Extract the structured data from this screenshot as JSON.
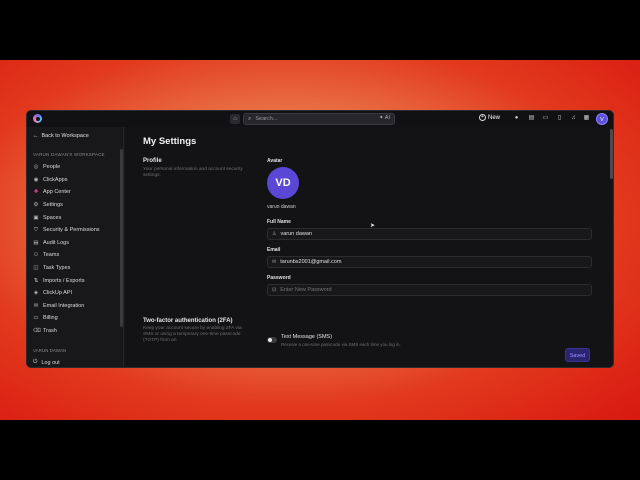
{
  "topbar": {
    "search_placeholder": "Search...",
    "ai_label": "AI",
    "new_label": "New",
    "user_initial": "V"
  },
  "sidebar": {
    "back_label": "Back to Workspace",
    "workspace_label": "VARUN DAWAN'S WORKSPACE",
    "items": [
      {
        "label": "People",
        "icon": "people-icon"
      },
      {
        "label": "ClickApps",
        "icon": "clickapps-icon"
      },
      {
        "label": "App Center",
        "icon": "app-center-icon"
      },
      {
        "label": "Settings",
        "icon": "gear-icon"
      },
      {
        "label": "Spaces",
        "icon": "spaces-icon"
      },
      {
        "label": "Security & Permissions",
        "icon": "shield-icon"
      },
      {
        "label": "Audit Logs",
        "icon": "audit-logs-icon"
      },
      {
        "label": "Teams",
        "icon": "teams-icon"
      },
      {
        "label": "Task Types",
        "icon": "task-types-icon"
      },
      {
        "label": "Imports / Exports",
        "icon": "imports-icon"
      },
      {
        "label": "ClickUp API",
        "icon": "api-icon"
      },
      {
        "label": "Email Integration",
        "icon": "email-icon"
      },
      {
        "label": "Billing",
        "icon": "billing-icon"
      },
      {
        "label": "Trash",
        "icon": "trash-icon"
      }
    ],
    "user_label": "VARUN DAWAN",
    "logout_label": "Log out"
  },
  "main": {
    "title": "My Settings",
    "profile": {
      "title": "Profile",
      "description": "Your personal information and account security settings.",
      "avatar_label": "Avatar",
      "avatar_initials": "VD",
      "avatar_name": "varun dawan",
      "full_name_label": "Full Name",
      "full_name_value": "varun dawan",
      "email_label": "Email",
      "email_value": "tarunbs2001@gmail.com",
      "password_label": "Password",
      "password_placeholder": "Enter New Password"
    },
    "twofa": {
      "title": "Two-factor authentication (2FA)",
      "description": "Keep your account secure by enabling 2FA via SMS or using a temporary one-time passcode (TOTP) from an",
      "sms_title": "Text Message (SMS)",
      "sms_description": "Receive a one-time passcode via SMS each time you log in.",
      "sms_enabled": false
    },
    "saved_label": "Saved"
  },
  "colors": {
    "accent": "#5a47d6",
    "background": "#131315"
  }
}
